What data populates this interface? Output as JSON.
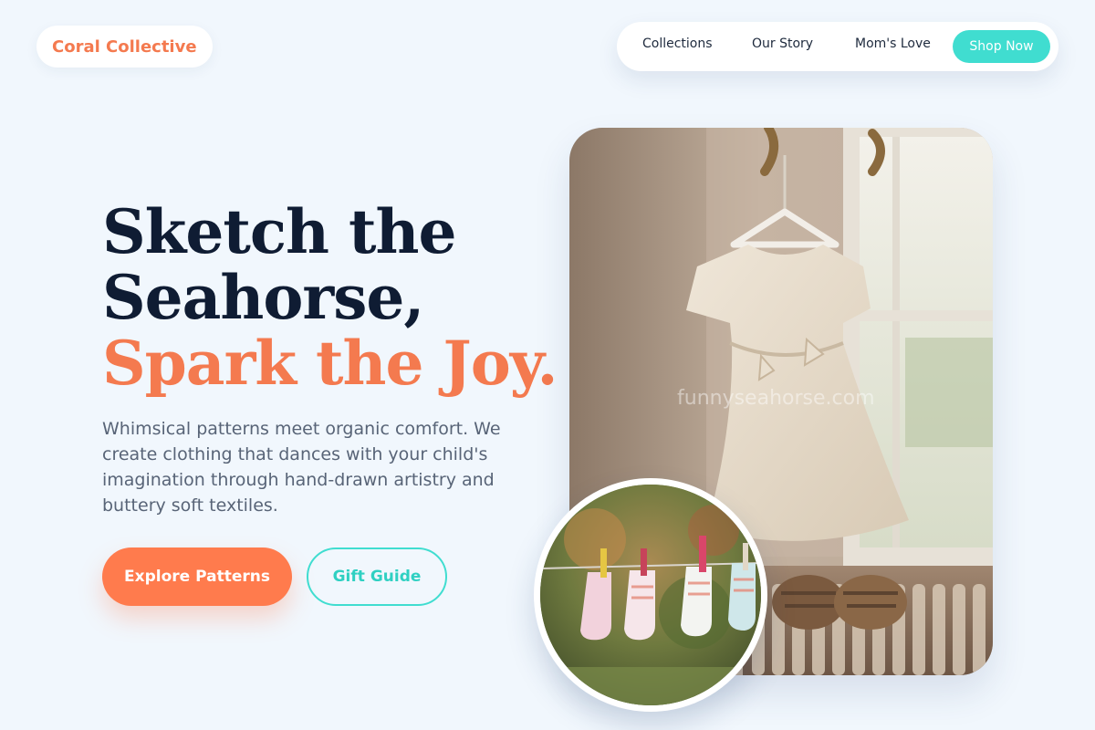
{
  "brand": {
    "name": "Coral Collective"
  },
  "nav": {
    "links": [
      "Collections",
      "Our Story",
      "Mom's Love"
    ],
    "cta": "Shop Now"
  },
  "hero": {
    "headline_line1": "Sketch the",
    "headline_line2": "Seahorse,",
    "headline_accent": "Spark the Joy.",
    "description": "Whimsical patterns meet organic comfort. We create clothing that dances with your child's imagination through hand-drawn artistry and buttery soft textiles.",
    "primary_button": "Explore Patterns",
    "secondary_button": "Gift Guide"
  },
  "images": {
    "main_alt": "White textured toddler dress on a hanger by a window with brown sandals on a radiator",
    "main_watermark": "funnyseahorse.com",
    "inset_alt": "Baby socks hanging on a clothesline with clothespins"
  },
  "colors": {
    "accent": "#f47a4f",
    "button_coral": "#ff7b4d",
    "teal": "#40ddd0",
    "background": "#f1f7fd",
    "ink": "#0f1c33"
  }
}
